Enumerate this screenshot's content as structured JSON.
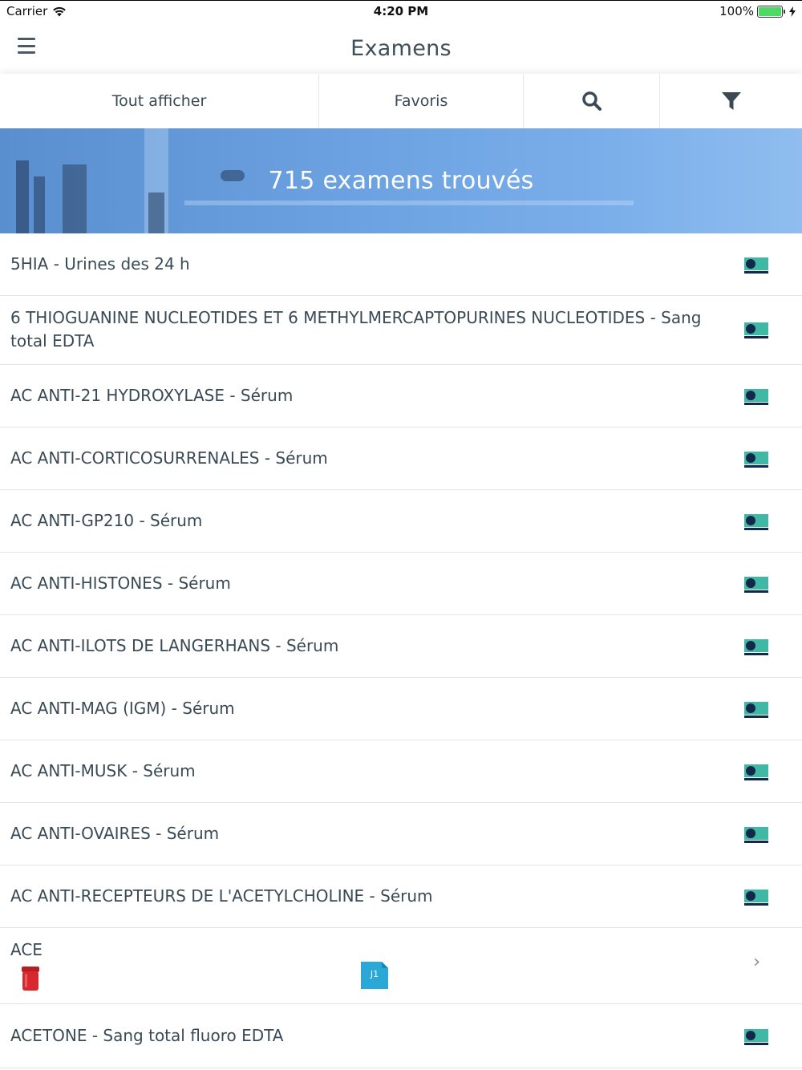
{
  "status_bar": {
    "carrier": "Carrier",
    "time": "4:20 PM",
    "battery": "100%",
    "battery_level": 1.0
  },
  "header": {
    "title": "Examens"
  },
  "tabs": [
    {
      "label": "Tout afficher"
    },
    {
      "label": "Favoris"
    },
    {
      "icon": "search-icon"
    },
    {
      "icon": "filter-icon"
    }
  ],
  "banner": {
    "text": "715 examens trouvés"
  },
  "exams": [
    {
      "label": "5HIA - Urines des 24 h",
      "icon": "exam-card-icon"
    },
    {
      "label": "6 THIOGUANINE NUCLEOTIDES ET 6 METHYLMERCAPTOPURINES NUCLEOTIDES - Sang total EDTA",
      "icon": "exam-card-icon"
    },
    {
      "label": "AC ANTI-21 HYDROXYLASE - Sérum",
      "icon": "exam-card-icon"
    },
    {
      "label": "AC ANTI-CORTICOSURRENALES - Sérum",
      "icon": "exam-card-icon"
    },
    {
      "label": "AC ANTI-GP210 - Sérum",
      "icon": "exam-card-icon"
    },
    {
      "label": "AC ANTI-HISTONES - Sérum",
      "icon": "exam-card-icon"
    },
    {
      "label": "AC ANTI-ILOTS DE LANGERHANS - Sérum",
      "icon": "exam-card-icon"
    },
    {
      "label": "AC ANTI-MAG (IGM) - Sérum",
      "icon": "exam-card-icon"
    },
    {
      "label": "AC ANTI-MUSK - Sérum",
      "icon": "exam-card-icon"
    },
    {
      "label": "AC ANTI-OVAIRES - Sérum",
      "icon": "exam-card-icon"
    },
    {
      "label": "AC ANTI-RECEPTEURS DE L'ACETYLCHOLINE - Sérum",
      "icon": "exam-card-icon"
    },
    {
      "label": "ACE",
      "icon": "chevron-right-icon",
      "doc_badge": "J1"
    },
    {
      "label": "ACETONE - Sang total fluoro EDTA",
      "icon": "exam-card-icon"
    }
  ],
  "colors": {
    "text": "#3a4a55",
    "banner": "#6aa0e0",
    "icon_navy": "#13294b",
    "icon_teal": "#3fb9a5",
    "tube_red": "#d8282e",
    "doc_blue": "#2aa9d8"
  }
}
